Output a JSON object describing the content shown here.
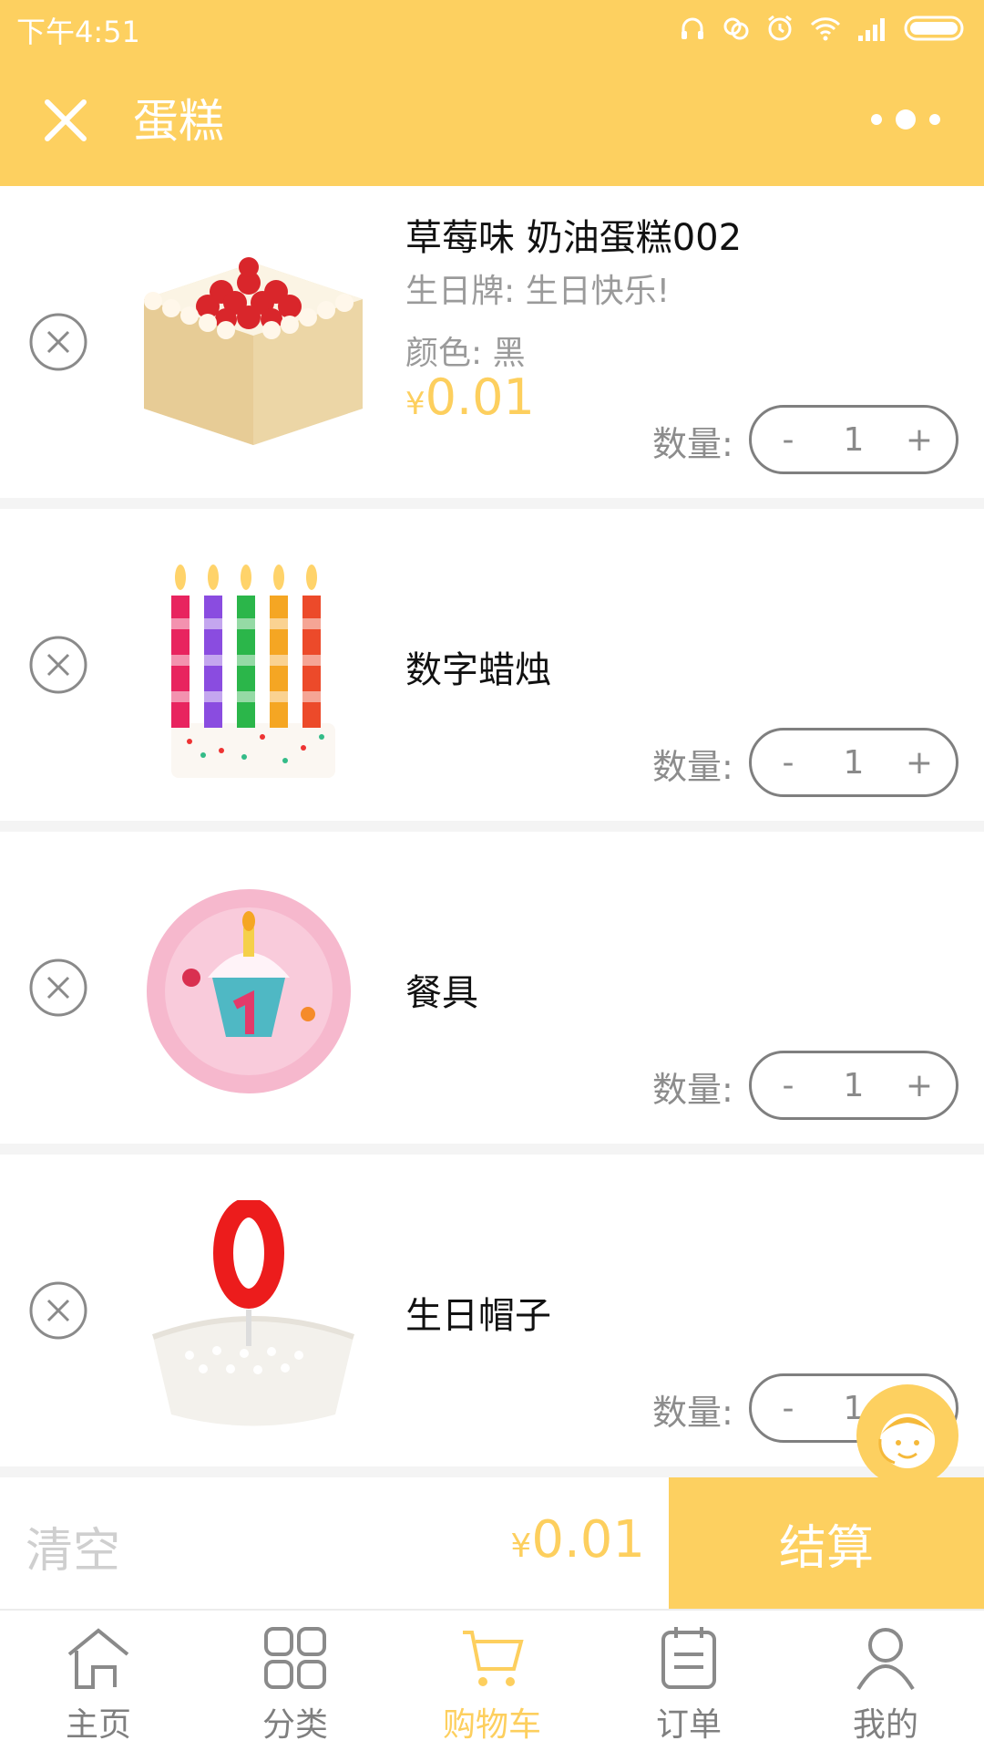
{
  "status": {
    "time": "下午4:51"
  },
  "header": {
    "title": "蛋糕"
  },
  "cart": {
    "qty_label": "数量:",
    "items": [
      {
        "name": "草莓味 奶油蛋糕002",
        "attr1": "生日牌: 生日快乐!",
        "attr2": "颜色: 黑",
        "price_symbol": "¥",
        "price": "0.01",
        "qty": "1",
        "image_icon": "strawberry-cake-image"
      },
      {
        "name": "数字蜡烛",
        "qty": "1",
        "image_icon": "candles-image"
      },
      {
        "name": "餐具",
        "qty": "1",
        "image_icon": "birthday-plate-image"
      },
      {
        "name": "生日帽子",
        "qty": "1",
        "image_icon": "number-zero-candle-image"
      }
    ]
  },
  "checkout": {
    "clear_label": "清空",
    "total_symbol": "¥",
    "total": "0.01",
    "button_label": "结算"
  },
  "tabs": [
    {
      "label": "主页",
      "icon": "home-icon",
      "active": false
    },
    {
      "label": "分类",
      "icon": "category-icon",
      "active": false
    },
    {
      "label": "购物车",
      "icon": "cart-icon",
      "active": true
    },
    {
      "label": "订单",
      "icon": "order-icon",
      "active": false
    },
    {
      "label": "我的",
      "icon": "profile-icon",
      "active": false
    }
  ],
  "colors": {
    "accent": "#fdd060",
    "price": "#fdcf5e",
    "muted": "#9a9a9a"
  }
}
